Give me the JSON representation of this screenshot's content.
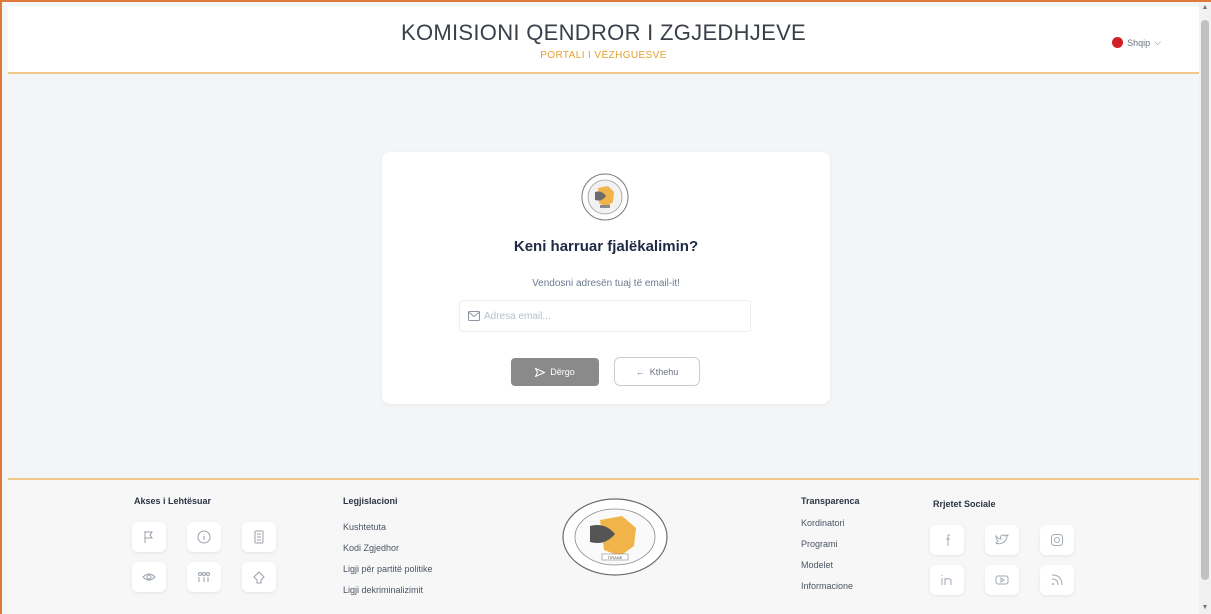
{
  "header": {
    "title": "KOMISIONI QENDROR I ZGJEDHJEVE",
    "subtitle": "PORTALI I VËZHGUESVE",
    "language": "Shqip"
  },
  "card": {
    "title": "Keni harruar fjalëkalimin?",
    "subtitle": "Vendosni adresën tuaj të email-it!",
    "email_placeholder": "Adresa email...",
    "send_label": "Dërgo",
    "back_label": "Kthehu"
  },
  "footer": {
    "accessibility_title": "Akses i Lehtësuar",
    "legislation_title": "Legjislacioni",
    "legislation_links": [
      "Kushtetuta",
      "Kodi Zgjedhor",
      "Ligji për partitë politike",
      "Ligji dekriminalizimit"
    ],
    "transparency_title": "Transparenca",
    "transparency_links": [
      "Kordinatori",
      "Programi",
      "Modelet",
      "Informacione"
    ],
    "social_title": "Rrjetet Sociale",
    "logo_text": "TIRANE"
  },
  "colors": {
    "accent": "#e2a12f",
    "border": "#f0c98a",
    "send_button": "#8a8a8a"
  }
}
